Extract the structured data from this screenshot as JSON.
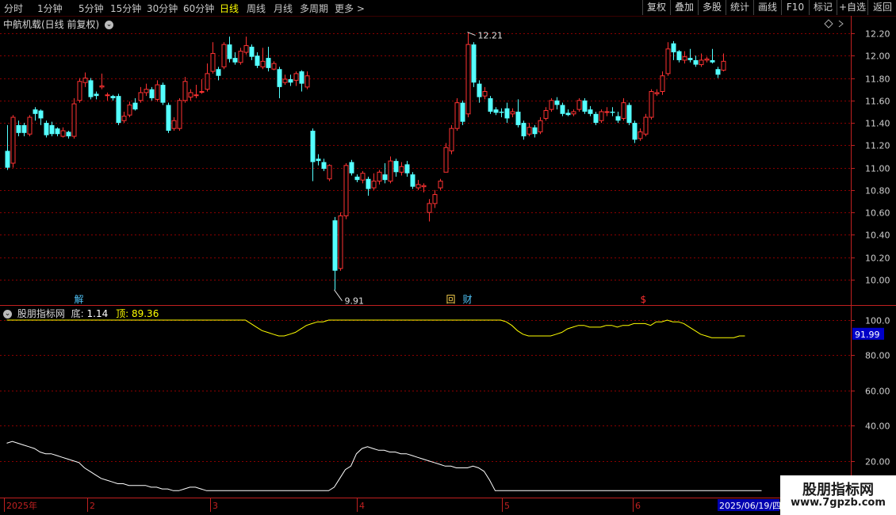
{
  "toolbar": {
    "periods": [
      "分时",
      "1分钟",
      "5分钟",
      "15分钟",
      "30分钟",
      "60分钟",
      "日线",
      "周线",
      "月线",
      "多周期",
      "更多 >"
    ],
    "active_period": "日线",
    "buttons": [
      "复权",
      "叠加",
      "多股",
      "统计",
      "画线",
      "F10",
      "标记",
      "+自选",
      "返回"
    ]
  },
  "stock": {
    "title": "中航机载(日线 前复权)",
    "max_label": "12.21",
    "min_label": "9.91"
  },
  "markers": [
    {
      "text": "解",
      "color": "#4fc3f7",
      "date": "2025-01-20"
    },
    {
      "text": "回",
      "color": "#ffd54f",
      "date": "2025-04-24"
    },
    {
      "text": "财",
      "color": "#4fc3f7",
      "date": "2025-04-28"
    },
    {
      "text": "$",
      "color": "#ff3030",
      "date": "2025-06-12"
    }
  ],
  "indicator": {
    "name": "股朋指标网",
    "bottom_label": "底:",
    "bottom_value": "1.14",
    "top_label": "顶:",
    "top_value": "89.36",
    "current_value": "91.99"
  },
  "date_axis": {
    "labels": [
      "2025年",
      "2",
      "3",
      "4",
      "5",
      "6"
    ],
    "current_date": "2025/06/19/四"
  },
  "watermark": {
    "line1": "股朋指标网",
    "line2": "www.7gpzb.com"
  },
  "colors": {
    "up": "#ff3232",
    "down": "#54ffff",
    "grid": "#8a0000",
    "axis": "#c02020",
    "yellow": "#ffff00",
    "white": "#ffffff"
  },
  "chart_data": [
    {
      "type": "candlestick",
      "title": "中航机载(日线 前复权)",
      "y_ticks": [
        10.0,
        10.2,
        10.4,
        10.6,
        10.8,
        11.0,
        11.2,
        11.4,
        11.6,
        11.8,
        12.0,
        12.2
      ],
      "ylim": [
        9.85,
        12.32
      ],
      "x_labels": [
        "2025年",
        "2",
        "3",
        "4",
        "5",
        "6"
      ],
      "annotations": [
        {
          "text": "12.21",
          "value": 12.21
        },
        {
          "text": "9.91",
          "value": 9.91
        }
      ],
      "candles": [
        [
          11.15,
          11.0,
          11.38,
          10.98
        ],
        [
          11.04,
          11.45,
          11.47,
          11.0
        ],
        [
          11.38,
          11.31,
          11.42,
          11.28
        ],
        [
          11.38,
          11.31,
          11.4,
          11.28
        ],
        [
          11.3,
          11.45,
          11.47,
          11.28
        ],
        [
          11.52,
          11.48,
          11.54,
          11.42
        ],
        [
          11.51,
          11.44,
          11.52,
          11.38
        ],
        [
          11.4,
          11.29,
          11.42,
          11.27
        ],
        [
          11.38,
          11.3,
          11.41,
          11.28
        ],
        [
          11.35,
          11.3,
          11.36,
          11.28
        ],
        [
          11.28,
          11.33,
          11.36,
          11.27
        ],
        [
          11.32,
          11.28,
          11.33,
          11.26
        ],
        [
          11.28,
          11.57,
          11.62,
          11.26
        ],
        [
          11.6,
          11.77,
          11.8,
          11.58
        ],
        [
          11.76,
          11.8,
          11.85,
          11.72
        ],
        [
          11.78,
          11.63,
          11.8,
          11.61
        ],
        [
          11.66,
          11.64,
          11.68,
          11.61
        ],
        [
          11.72,
          11.73,
          11.84,
          11.7
        ],
        [
          11.65,
          11.65,
          11.67,
          11.6
        ],
        [
          11.64,
          11.62,
          11.65,
          11.6
        ],
        [
          11.64,
          11.4,
          11.66,
          11.38
        ],
        [
          11.42,
          11.46,
          11.5,
          11.4
        ],
        [
          11.47,
          11.56,
          11.59,
          11.45
        ],
        [
          11.58,
          11.52,
          11.62,
          11.51
        ],
        [
          11.6,
          11.67,
          11.72,
          11.58
        ],
        [
          11.67,
          11.7,
          11.75,
          11.64
        ],
        [
          11.7,
          11.62,
          11.72,
          11.6
        ],
        [
          11.61,
          11.74,
          11.78,
          11.59
        ],
        [
          11.74,
          11.58,
          11.76,
          11.56
        ],
        [
          11.56,
          11.33,
          11.58,
          11.31
        ],
        [
          11.35,
          11.42,
          11.45,
          11.33
        ],
        [
          11.35,
          11.6,
          11.62,
          11.33
        ],
        [
          11.6,
          11.77,
          11.81,
          11.58
        ],
        [
          11.63,
          11.67,
          11.7,
          11.6
        ],
        [
          11.65,
          11.65,
          11.74,
          11.62
        ],
        [
          11.68,
          11.68,
          11.79,
          11.66
        ],
        [
          11.7,
          11.84,
          11.93,
          11.68
        ],
        [
          11.86,
          12.02,
          12.12,
          11.84
        ],
        [
          11.88,
          11.82,
          11.9,
          11.78
        ],
        [
          11.9,
          12.1,
          12.12,
          11.88
        ],
        [
          12.1,
          11.97,
          12.17,
          11.94
        ],
        [
          11.98,
          11.94,
          12.03,
          11.92
        ],
        [
          11.94,
          12.04,
          12.07,
          11.92
        ],
        [
          12.03,
          12.09,
          12.17,
          12.01
        ],
        [
          12.08,
          11.99,
          12.1,
          11.96
        ],
        [
          12.0,
          11.91,
          12.03,
          11.89
        ],
        [
          11.9,
          11.95,
          12.07,
          11.88
        ],
        [
          11.98,
          11.89,
          12.08,
          11.86
        ],
        [
          11.88,
          11.93,
          11.95,
          11.87
        ],
        [
          11.88,
          11.72,
          11.9,
          11.62
        ],
        [
          11.76,
          11.79,
          11.83,
          11.74
        ],
        [
          11.79,
          11.76,
          11.83,
          11.73
        ],
        [
          11.78,
          11.84,
          11.86,
          11.73
        ],
        [
          11.86,
          11.75,
          11.87,
          11.68
        ],
        [
          11.72,
          11.82,
          11.86,
          11.7
        ],
        [
          11.33,
          11.05,
          11.35,
          10.88
        ],
        [
          11.08,
          11.06,
          11.12,
          11.02
        ],
        [
          11.05,
          10.99,
          11.08,
          10.97
        ],
        [
          10.9,
          11.02,
          11.03,
          10.88
        ],
        [
          10.53,
          10.08,
          10.56,
          9.91
        ],
        [
          10.1,
          10.57,
          10.6,
          10.08
        ],
        [
          10.57,
          11.02,
          11.04,
          10.54
        ],
        [
          11.05,
          10.95,
          11.07,
          10.93
        ],
        [
          10.92,
          10.89,
          10.94,
          10.87
        ],
        [
          10.89,
          10.95,
          10.97,
          10.86
        ],
        [
          10.9,
          10.81,
          10.92,
          10.75
        ],
        [
          10.82,
          10.88,
          10.95,
          10.8
        ],
        [
          10.88,
          10.96,
          10.98,
          10.85
        ],
        [
          10.94,
          10.89,
          11.04,
          10.86
        ],
        [
          10.88,
          11.06,
          11.1,
          10.86
        ],
        [
          11.06,
          10.96,
          11.08,
          10.92
        ],
        [
          10.96,
          11.01,
          11.05,
          10.93
        ],
        [
          11.03,
          10.95,
          11.06,
          10.92
        ],
        [
          10.94,
          10.83,
          10.96,
          10.81
        ],
        [
          10.82,
          10.85,
          10.89,
          10.8
        ],
        [
          10.83,
          10.84,
          10.86,
          10.78
        ],
        [
          10.6,
          10.68,
          10.72,
          10.52
        ],
        [
          10.68,
          10.76,
          10.8,
          10.64
        ],
        [
          10.82,
          10.88,
          10.9,
          10.8
        ],
        [
          10.96,
          11.18,
          11.22,
          10.96
        ],
        [
          11.15,
          11.35,
          11.38,
          11.12
        ],
        [
          11.35,
          11.58,
          11.62,
          11.33
        ],
        [
          11.58,
          11.41,
          11.6,
          11.38
        ],
        [
          11.48,
          12.1,
          12.21,
          11.45
        ],
        [
          12.1,
          11.76,
          12.12,
          11.72
        ],
        [
          11.75,
          11.63,
          11.78,
          11.58
        ],
        [
          11.64,
          11.68,
          11.72,
          11.61
        ],
        [
          11.62,
          11.5,
          11.64,
          11.48
        ],
        [
          11.52,
          11.49,
          11.54,
          11.47
        ],
        [
          11.5,
          11.49,
          11.53,
          11.45
        ],
        [
          11.53,
          11.44,
          11.58,
          11.4
        ],
        [
          11.48,
          11.5,
          11.53,
          11.45
        ],
        [
          11.5,
          11.38,
          11.61,
          11.36
        ],
        [
          11.4,
          11.28,
          11.42,
          11.25
        ],
        [
          11.3,
          11.36,
          11.4,
          11.28
        ],
        [
          11.36,
          11.3,
          11.38,
          11.27
        ],
        [
          11.32,
          11.42,
          11.45,
          11.3
        ],
        [
          11.44,
          11.51,
          11.54,
          11.42
        ],
        [
          11.52,
          11.6,
          11.62,
          11.5
        ],
        [
          11.6,
          11.56,
          11.63,
          11.52
        ],
        [
          11.56,
          11.48,
          11.58,
          11.46
        ],
        [
          11.49,
          11.47,
          11.52,
          11.46
        ],
        [
          11.48,
          11.5,
          11.52,
          11.46
        ],
        [
          11.52,
          11.6,
          11.62,
          11.5
        ],
        [
          11.6,
          11.5,
          11.62,
          11.48
        ],
        [
          11.52,
          11.48,
          11.55,
          11.46
        ],
        [
          11.48,
          11.4,
          11.5,
          11.38
        ],
        [
          11.42,
          11.5,
          11.52,
          11.4
        ],
        [
          11.5,
          11.5,
          11.54,
          11.46
        ],
        [
          11.5,
          11.49,
          11.54,
          11.46
        ],
        [
          11.46,
          11.42,
          11.5,
          11.4
        ],
        [
          11.44,
          11.58,
          11.62,
          11.42
        ],
        [
          11.56,
          11.4,
          11.58,
          11.38
        ],
        [
          11.4,
          11.25,
          11.42,
          11.22
        ],
        [
          11.26,
          11.32,
          11.35,
          11.24
        ],
        [
          11.3,
          11.45,
          11.48,
          11.28
        ],
        [
          11.45,
          11.68,
          11.7,
          11.43
        ],
        [
          11.66,
          11.67,
          11.7,
          11.64
        ],
        [
          11.68,
          11.82,
          11.86,
          11.65
        ],
        [
          11.84,
          12.06,
          12.12,
          11.82
        ],
        [
          12.11,
          12.03,
          12.13,
          11.96
        ],
        [
          12.04,
          11.96,
          12.05,
          11.94
        ],
        [
          11.96,
          11.99,
          12.04,
          11.93
        ],
        [
          11.98,
          11.96,
          12.06,
          11.94
        ],
        [
          11.96,
          11.92,
          12.0,
          11.9
        ],
        [
          11.92,
          11.96,
          12.02,
          11.9
        ],
        [
          11.96,
          11.97,
          11.99,
          11.94
        ],
        [
          11.96,
          11.94,
          12.06,
          11.93
        ],
        [
          11.88,
          11.83,
          11.9,
          11.8
        ],
        [
          11.87,
          11.95,
          12.02,
          11.86
        ]
      ]
    },
    {
      "type": "line",
      "title": "股朋指标网",
      "y_ticks": [
        20.0,
        40.0,
        60.0,
        80.0,
        100.0
      ],
      "ylim": [
        0,
        101
      ],
      "series": [
        {
          "color": "#ffff00",
          "values": [
            100,
            100,
            100,
            100,
            100,
            100,
            100,
            100,
            100,
            100,
            100,
            100,
            100,
            100,
            100,
            100,
            100,
            100,
            100,
            100,
            100,
            100,
            100,
            100,
            100,
            100,
            100,
            100,
            100,
            100,
            100,
            100,
            100,
            100,
            100,
            100,
            100,
            100,
            100,
            100,
            100,
            100,
            100,
            100,
            98,
            96,
            94,
            93,
            92,
            91,
            91,
            92,
            93,
            95,
            97,
            98,
            99,
            99,
            100,
            100,
            100,
            100,
            100,
            100,
            100,
            100,
            100,
            100,
            100,
            100,
            100,
            100,
            100,
            100,
            100,
            100,
            100,
            100,
            100,
            100,
            100,
            100,
            100,
            100,
            100,
            100,
            100,
            100,
            100,
            100,
            99,
            97,
            94,
            92,
            91,
            91,
            91,
            91,
            91,
            92,
            93,
            95,
            96,
            97,
            97,
            96,
            96,
            96,
            97,
            97,
            96,
            97,
            97,
            98,
            98,
            98,
            97,
            99,
            99,
            100,
            99,
            99,
            98,
            96,
            94,
            92,
            91,
            90,
            90,
            90,
            90,
            90,
            91,
            91
          ]
        },
        {
          "color": "#ffffff",
          "values": [
            30,
            31,
            30,
            29,
            28,
            27,
            25,
            24,
            24,
            23,
            22,
            21,
            20,
            19,
            16,
            14,
            12,
            10,
            9,
            8,
            7,
            7,
            6,
            6,
            6,
            6,
            5,
            5,
            4,
            4,
            3,
            3,
            4,
            5,
            5,
            4,
            3,
            3,
            3,
            3,
            3,
            3,
            3,
            3,
            3,
            3,
            3,
            3,
            3,
            3,
            3,
            3,
            3,
            3,
            3,
            3,
            3,
            3,
            3,
            5,
            10,
            15,
            17,
            24,
            27,
            28,
            27,
            26,
            26,
            25,
            25,
            24,
            24,
            23,
            22,
            21,
            20,
            19,
            18,
            17,
            17,
            16,
            16,
            16,
            17,
            16,
            14,
            9,
            3,
            3,
            3,
            3,
            3,
            3,
            3,
            3,
            3,
            3,
            3,
            3,
            3,
            3,
            3,
            3,
            3,
            3,
            3,
            3,
            3,
            3,
            3,
            3,
            3,
            3,
            3,
            3,
            3,
            3,
            3,
            3,
            3,
            3,
            3,
            3,
            3,
            3,
            3,
            3,
            3,
            3,
            3,
            3,
            3,
            3,
            3,
            3,
            3
          ]
        }
      ]
    }
  ]
}
